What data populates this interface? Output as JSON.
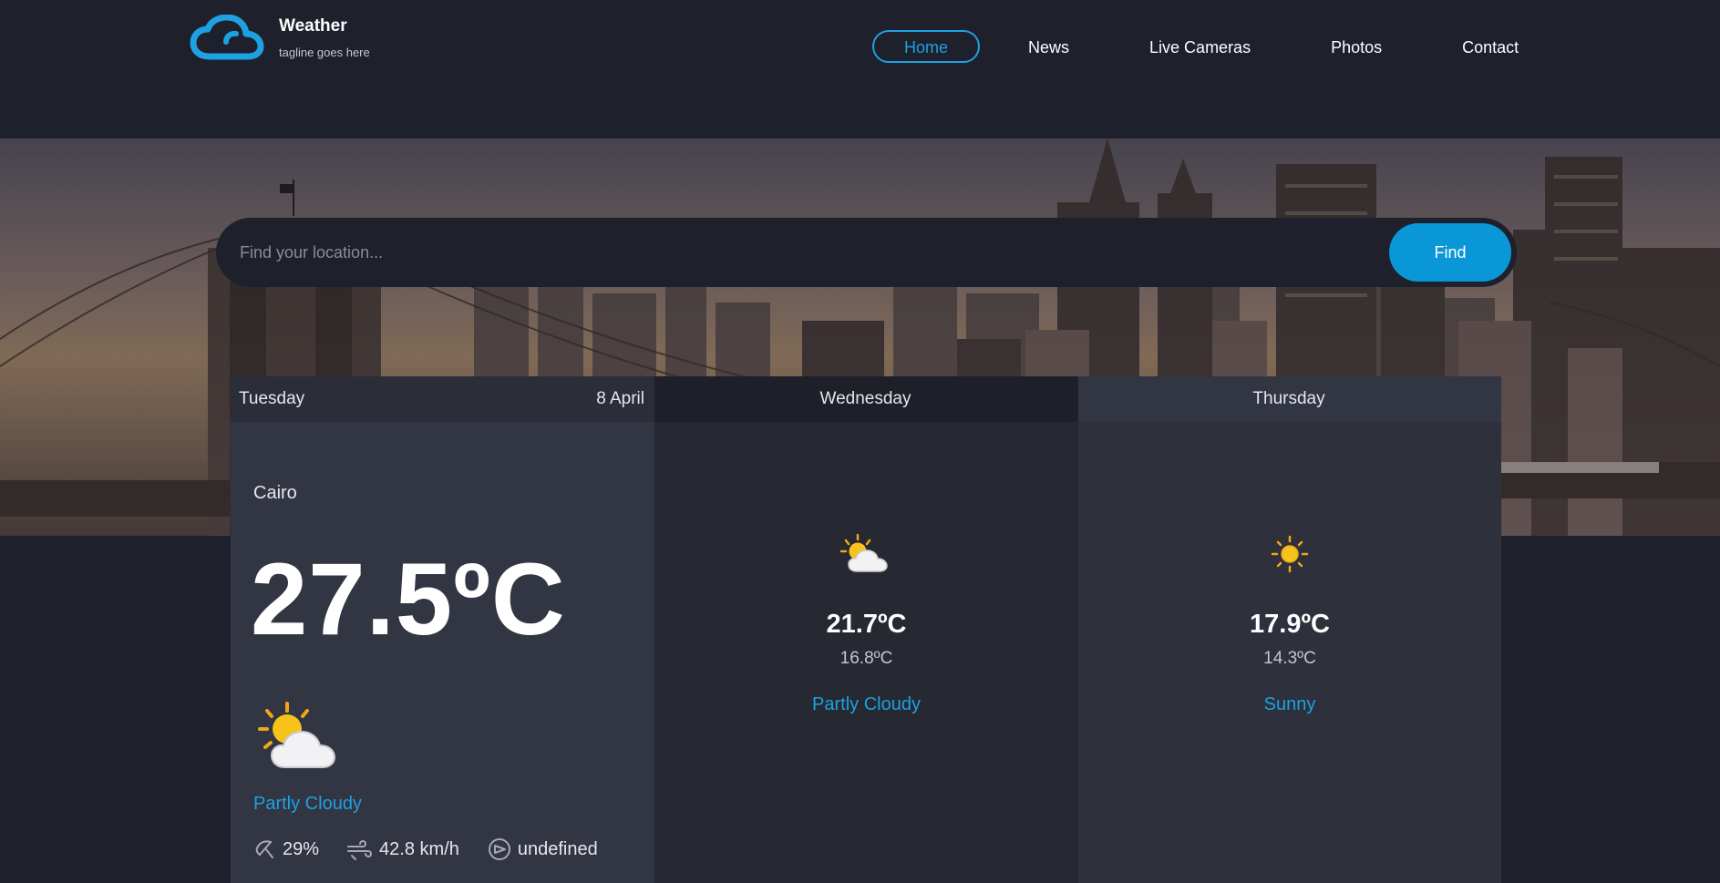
{
  "brand": {
    "title": "Weather",
    "tagline": "tagline goes here",
    "logo_icon": "cloud-icon",
    "accent_color": "#1da1e2"
  },
  "nav": {
    "items": [
      {
        "label": "Home",
        "active": true
      },
      {
        "label": "News",
        "active": false
      },
      {
        "label": "Live Cameras",
        "active": false
      },
      {
        "label": "Photos",
        "active": false
      },
      {
        "label": "Contact",
        "active": false
      }
    ]
  },
  "search": {
    "placeholder": "Find your location...",
    "value": "",
    "button_label": "Find"
  },
  "forecast": {
    "today": {
      "day": "Tuesday",
      "date": "8 April",
      "location": "Cairo",
      "temperature": "27.5ºC",
      "icon": "partly-cloudy-icon",
      "condition": "Partly Cloudy",
      "humidity": "29%",
      "wind_speed": "42.8 km/h",
      "wind_direction": "undefined"
    },
    "next_days": [
      {
        "day": "Wednesday",
        "icon": "partly-cloudy-icon",
        "max_temp": "21.7ºC",
        "min_temp": "16.8ºC",
        "condition": "Partly Cloudy"
      },
      {
        "day": "Thursday",
        "icon": "sun-icon",
        "max_temp": "17.9ºC",
        "min_temp": "14.3ºC",
        "condition": "Sunny"
      }
    ]
  }
}
